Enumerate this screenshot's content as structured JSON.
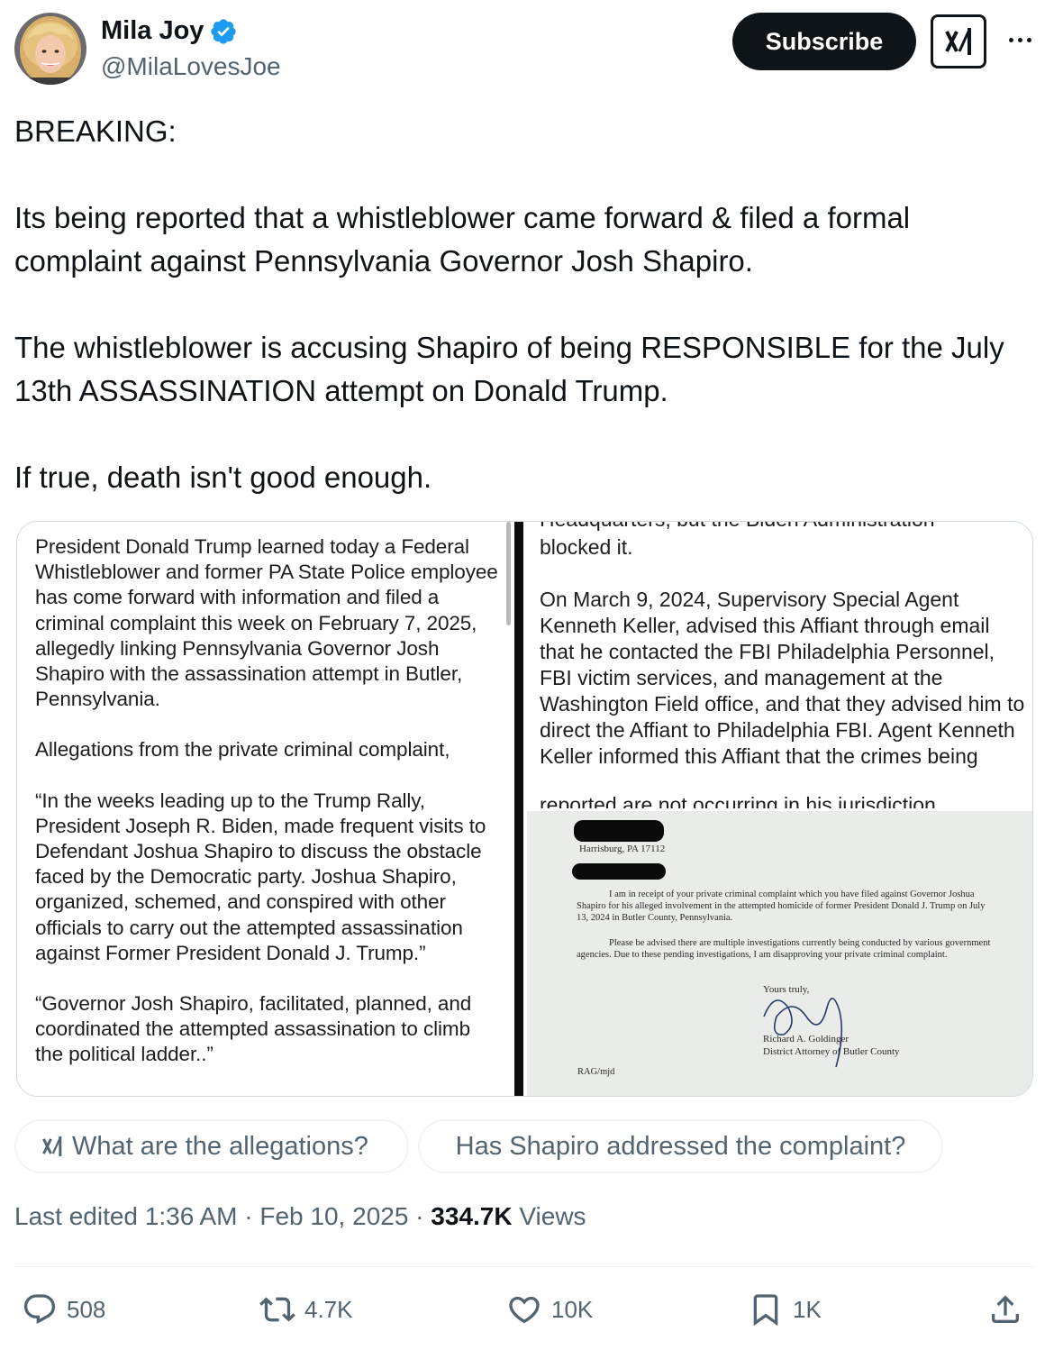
{
  "author": {
    "name": "Mila Joy",
    "handle": "@MilaLovesJoe",
    "verified": true,
    "avatar_icon": "user-avatar"
  },
  "header": {
    "subscribe_label": "Subscribe",
    "grok_icon": "grok-icon",
    "more_icon": "more-horizontal-icon"
  },
  "tweet": {
    "lines": [
      "BREAKING:",
      "Its being reported that a whistleblower came forward & filed a formal complaint against Pennsylvania Governor Josh Shapiro.",
      "The whistleblower is accusing Shapiro of being RESPONSIBLE for the July 13th ASSASSINATION attempt on Donald Trump.",
      "If true, death isn't good enough."
    ]
  },
  "media": {
    "left": {
      "p1": "President Donald Trump learned today a Federal Whistleblower and former PA State Police employee has come forward with information and filed a criminal complaint this week on February 7, 2025, allegedly linking Pennsylvania Governor Josh Shapiro with the assassination attempt in Butler, Pennsylvania.",
      "p2": "Allegations from the private criminal complaint,",
      "p3": "“In the weeks leading up to the Trump Rally, President Joseph R. Biden, made frequent visits to Defendant Joshua Shapiro to discuss the obstacle faced by the Democratic party. Joshua Shapiro, organized, schemed, and conspired with other officials to carry out the attempted assassination against Former President Donald J. Trump.”",
      "p4": "“Governor Josh Shapiro, facilitated, planned, and coordinated the attempted assassination to climb the political ladder..”"
    },
    "right_top": {
      "cut_top": "Headquarters, but the Biden Administration",
      "p1": "blocked it.",
      "p2": "On March 9, 2024, Supervisory Special Agent Kenneth Keller, advised this Affiant through email that he contacted the FBI Philadelphia Personnel, FBI victim services, and management at the Washington Field office, and that they advised him to direct the Affiant to Philadelphia FBI. Agent Kenneth Keller informed this Affiant that the crimes being",
      "cut_bottom": "reported are not occurring in his jurisdiction"
    },
    "letter": {
      "address": "Harrisburg, PA 17112",
      "p1": "I am in receipt of your private criminal complaint which you have filed against Governor Joshua Shapiro for his alleged involvement in the attempted homicide of former President Donald J. Trump on July 13, 2024 in Butler County, Pennsylvania.",
      "p2": "Please be advised there are multiple investigations currently being conducted by various government agencies.  Due to these pending investigations, I am disapproving your private criminal complaint.",
      "closing": "Yours truly,",
      "signer_name": "Richard A. Goldinger",
      "signer_title": "District Attorney of Butler County",
      "ref": "RAG/mjd"
    }
  },
  "chips": [
    {
      "label": "What are the allegations?",
      "icon": "grok-icon"
    },
    {
      "label": "Has Shapiro addressed the complaint?"
    }
  ],
  "meta": {
    "edited": "Last edited 1:36 AM · Feb 10, 2025 · ",
    "views_count": "334.7K",
    "views_label": " Views"
  },
  "actions": {
    "replies": "508",
    "reposts": "4.7K",
    "likes": "10K",
    "bookmarks": "1K"
  },
  "colors": {
    "text": "#0f1419",
    "secondary": "#536471",
    "verified": "#1d9bf0",
    "border": "#eff3f4"
  }
}
